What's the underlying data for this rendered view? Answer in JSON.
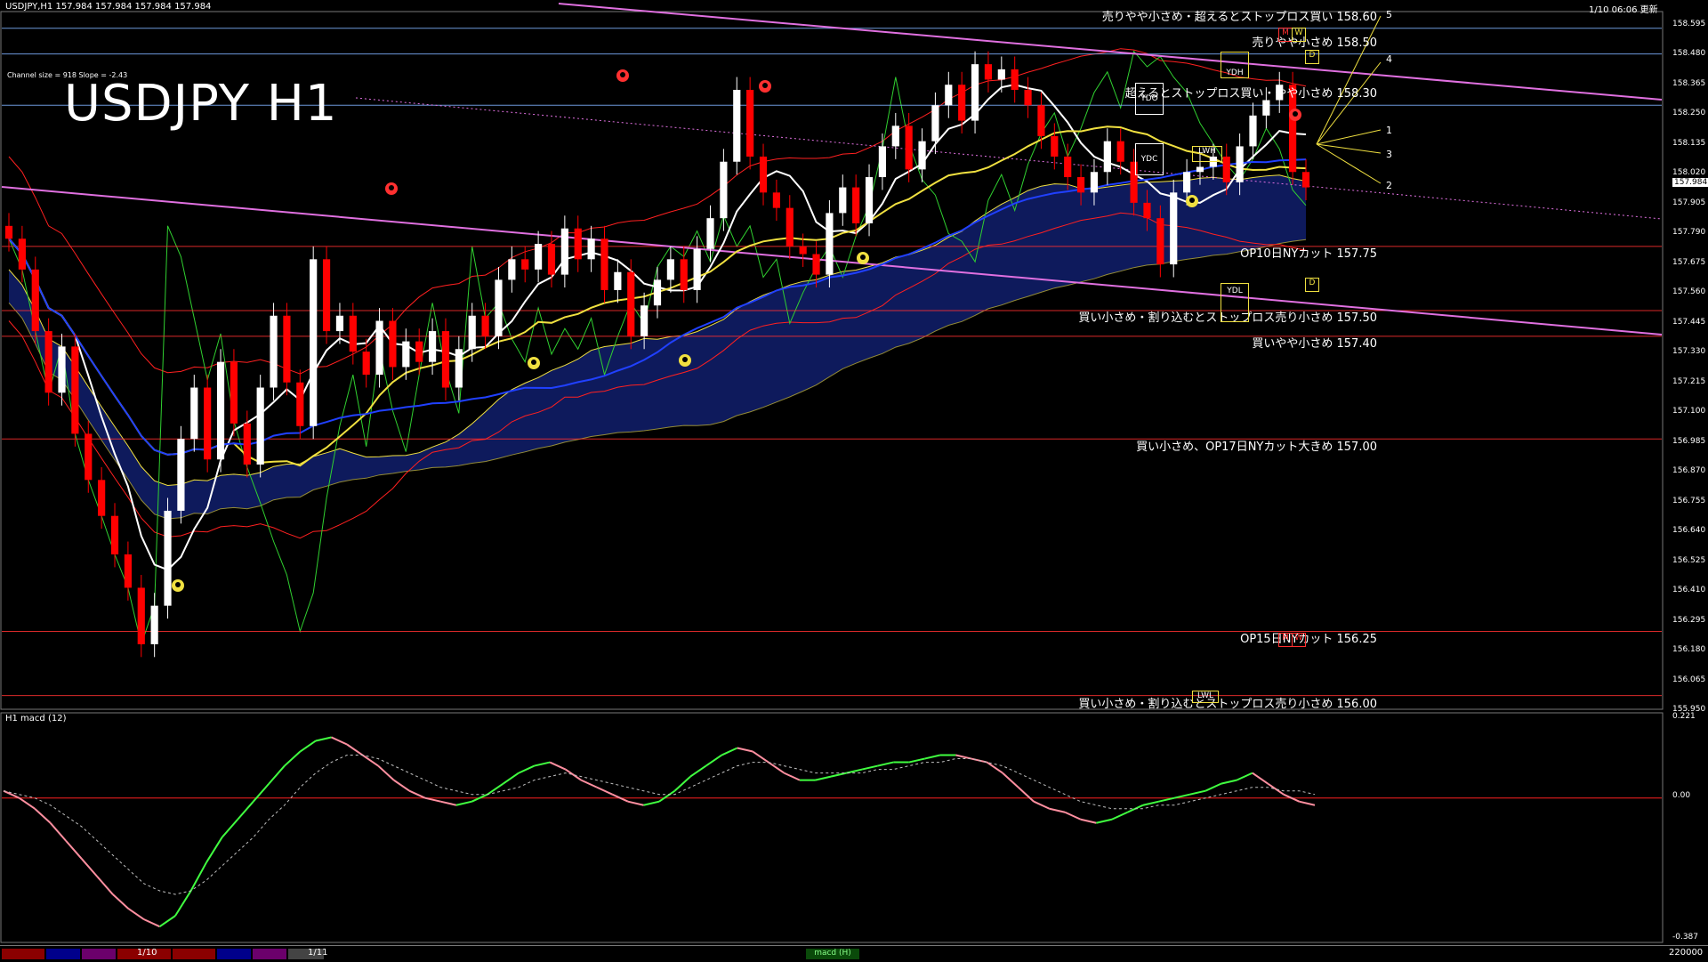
{
  "header": {
    "symbol_line": "USDJPY,H1  157.984 157.984 157.984 157.984",
    "timestamp": "1/10 06:06 更新",
    "channel_info": "Channel size = 918 Slope = -2.43",
    "big_title": "USDJPY H1",
    "macd_label": "H1  macd (12)"
  },
  "levels": [
    {
      "label": "売りやや小さめ・超えるとストップロス買い 158.60",
      "price": 158.6,
      "color": "#7fb2ff"
    },
    {
      "label": "売りやや小さめ 158.50",
      "price": 158.5,
      "color": "#7fb2ff"
    },
    {
      "label": "超えるとストップロス買い・やや小さめ 158.30",
      "price": 158.3,
      "color": "#7fb2ff"
    },
    {
      "label": "OP10日NYカット 157.75",
      "price": 157.75,
      "color": "#ff3030"
    },
    {
      "label": "買い小さめ・割り込むとストップロス売り小さめ 157.50",
      "price": 157.5,
      "color": "#ff3030"
    },
    {
      "label": "買いやや小さめ 157.40",
      "price": 157.4,
      "color": "#ff3030"
    },
    {
      "label": "買い小さめ、OP17日NYカット大きめ 157.00",
      "price": 157.0,
      "color": "#ff3030"
    },
    {
      "label": "OP15日NYカット 156.25",
      "price": 156.25,
      "color": "#ff3030"
    },
    {
      "label": "買い小さめ・割り込むとストップロス売り小さめ 156.00",
      "price": 156.0,
      "color": "#ff3030"
    }
  ],
  "markers": {
    "ydh": "YDH",
    "ydo": "YDO",
    "ydc": "YDC",
    "ydl": "YDL",
    "m": "M",
    "w": "W",
    "d": "D",
    "lwh": "LWH",
    "lwl": "LWL",
    "fan_labels": [
      "5",
      "4",
      "1",
      "3",
      "2"
    ]
  },
  "current_price": "157.984",
  "price_axis_labels": [
    "158.595",
    "158.480",
    "158.365",
    "158.250",
    "158.135",
    "158.020",
    "157.905",
    "157.790",
    "157.675",
    "157.560",
    "157.445",
    "157.330",
    "157.215",
    "157.100",
    "156.985",
    "156.870",
    "156.755",
    "156.640",
    "156.525",
    "156.410",
    "156.295",
    "156.180",
    "156.065",
    "155.950"
  ],
  "macd_axis_labels": {
    "top": "0.221",
    "zero": "0.00",
    "bottom": "-0.387"
  },
  "bottom_bar": {
    "date1": "1/10",
    "date2": "1/11",
    "right_text": "220000",
    "mid_tag": "macd (H)"
  },
  "colors": {
    "bull": "#ffffff",
    "bear": "#ff0000",
    "cloud": "#1a2fa8",
    "cloud2": "#c09070",
    "ma_white": "#ffffff",
    "ma_yellow": "#f0e040",
    "ma_blue": "#2040ff",
    "channel": "#e070e0",
    "macd_main": "#40ff40",
    "macd_neg": "#ff8fa0",
    "macd_signal": "#c0c0c0"
  },
  "chart_data": [
    {
      "type": "candlestick",
      "title": "USDJPY H1",
      "ylim": [
        155.95,
        158.62
      ],
      "close": [
        157.78,
        157.66,
        157.42,
        157.18,
        157.36,
        157.02,
        156.84,
        156.7,
        156.55,
        156.42,
        156.2,
        156.35,
        156.72,
        157.0,
        157.2,
        156.92,
        157.3,
        157.06,
        156.9,
        157.2,
        157.48,
        157.22,
        157.05,
        157.7,
        157.42,
        157.48,
        157.34,
        157.25,
        157.46,
        157.28,
        157.38,
        157.3,
        157.42,
        157.2,
        157.35,
        157.48,
        157.4,
        157.62,
        157.7,
        157.66,
        157.76,
        157.64,
        157.82,
        157.7,
        157.78,
        157.58,
        157.65,
        157.4,
        157.52,
        157.62,
        157.7,
        157.58,
        157.74,
        157.86,
        158.08,
        158.36,
        158.1,
        157.96,
        157.9,
        157.75,
        157.72,
        157.64,
        157.88,
        157.98,
        157.84,
        158.02,
        158.14,
        158.22,
        158.05,
        158.16,
        158.3,
        158.38,
        158.24,
        158.46,
        158.4,
        158.44,
        158.36,
        158.3,
        158.18,
        158.1,
        158.02,
        157.96,
        158.04,
        158.16,
        158.08,
        157.92,
        157.86,
        157.68,
        157.96,
        158.04,
        158.06,
        158.1,
        158.0,
        158.14,
        158.26,
        158.32,
        158.38,
        158.04,
        157.98
      ],
      "xlabel": "",
      "ylabel": ""
    },
    {
      "type": "line",
      "title": "",
      "series": [
        {
          "values": [
            0.02,
            0.0,
            -0.03,
            -0.07,
            -0.12,
            -0.17,
            -0.22,
            -0.27,
            -0.31,
            -0.34,
            -0.36,
            -0.33,
            -0.26,
            -0.18,
            -0.11,
            -0.06,
            -0.01,
            0.04,
            0.09,
            0.13,
            0.16,
            0.17,
            0.15,
            0.12,
            0.09,
            0.05,
            0.02,
            0.0,
            -0.01,
            -0.02,
            -0.01,
            0.01,
            0.04,
            0.07,
            0.09,
            0.1,
            0.08,
            0.05,
            0.03,
            0.01,
            -0.01,
            -0.02,
            -0.01,
            0.02,
            0.06,
            0.09,
            0.12,
            0.14,
            0.13,
            0.1,
            0.07,
            0.05,
            0.05,
            0.06,
            0.07,
            0.08,
            0.09,
            0.1,
            0.1,
            0.11,
            0.12,
            0.12,
            0.11,
            0.1,
            0.07,
            0.03,
            -0.01,
            -0.03,
            -0.04,
            -0.06,
            -0.07,
            -0.06,
            -0.04,
            -0.02,
            -0.01,
            0.0,
            0.01,
            0.02,
            0.04,
            0.05,
            0.07,
            0.04,
            0.01,
            -0.01,
            -0.02
          ]
        }
      ],
      "signal": [
        0.02,
        0.01,
        0.0,
        -0.02,
        -0.05,
        -0.08,
        -0.12,
        -0.16,
        -0.2,
        -0.24,
        -0.26,
        -0.27,
        -0.26,
        -0.23,
        -0.19,
        -0.15,
        -0.11,
        -0.06,
        -0.02,
        0.03,
        0.07,
        0.1,
        0.12,
        0.12,
        0.11,
        0.09,
        0.07,
        0.05,
        0.03,
        0.02,
        0.01,
        0.01,
        0.02,
        0.03,
        0.05,
        0.06,
        0.07,
        0.06,
        0.05,
        0.04,
        0.03,
        0.02,
        0.01,
        0.01,
        0.03,
        0.05,
        0.07,
        0.09,
        0.1,
        0.1,
        0.09,
        0.08,
        0.07,
        0.07,
        0.07,
        0.07,
        0.08,
        0.08,
        0.09,
        0.1,
        0.1,
        0.11,
        0.11,
        0.1,
        0.09,
        0.07,
        0.05,
        0.03,
        0.01,
        -0.01,
        -0.02,
        -0.03,
        -0.03,
        -0.03,
        -0.02,
        -0.02,
        -0.01,
        0.0,
        0.01,
        0.02,
        0.03,
        0.03,
        0.02,
        0.02,
        0.01
      ],
      "ylim": [
        -0.387,
        0.221
      ],
      "xlabel": "",
      "ylabel": ""
    }
  ]
}
